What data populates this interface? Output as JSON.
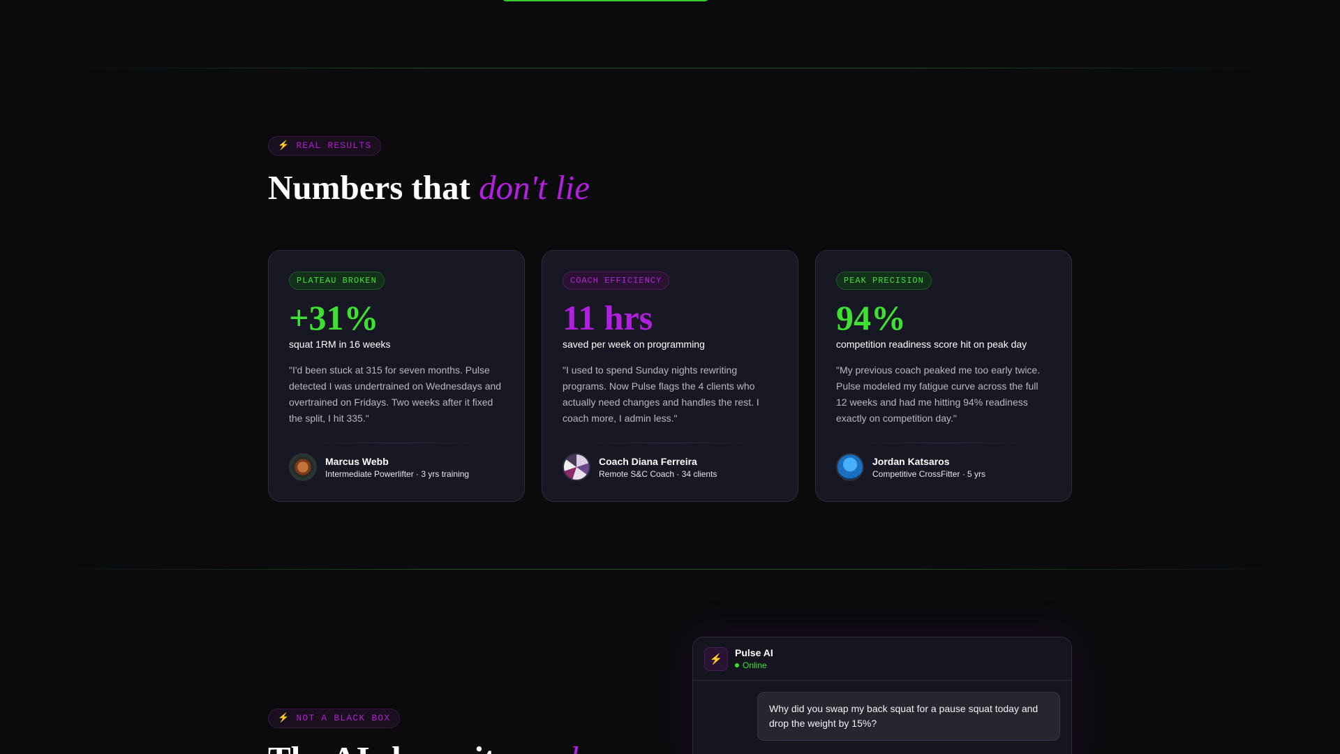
{
  "section1": {
    "eyebrow": "⚡ REAL RESULTS",
    "title_main": "Numbers that ",
    "title_accent": "don't lie"
  },
  "cards": [
    {
      "badge": "PLATEAU BROKEN",
      "metric": "+31%",
      "subtitle": "squat 1RM in 16 weeks",
      "quote": "\"I'd been stuck at 315 for seven months. Pulse detected I was undertrained on Wednesdays and overtrained on Fridays. Two weeks after it fixed the split, I hit 335.\"",
      "author": "Marcus Webb",
      "role": "Intermediate Powerlifter · 3 yrs training",
      "accent": "#3ee034"
    },
    {
      "badge": "COACH EFFICIENCY",
      "metric": "11 hrs",
      "subtitle": "saved per week on programming",
      "quote": "\"I used to spend Sunday nights rewriting programs. Now Pulse flags the 4 clients who actually need changes and handles the rest. I coach more, I admin less.\"",
      "author": "Coach Diana Ferreira",
      "role": "Remote S&C Coach · 34 clients",
      "accent": "#b01fe0"
    },
    {
      "badge": "PEAK PRECISION",
      "metric": "94%",
      "subtitle": "competition readiness score hit on peak day",
      "quote": "\"My previous coach peaked me too early twice. Pulse modeled my fatigue curve across the full 12 weeks and had me hitting 94% readiness exactly on competition day.\"",
      "author": "Jordan Katsaros",
      "role": "Competitive CrossFitter · 5 yrs",
      "accent": "#3ee034"
    }
  ],
  "section2": {
    "eyebrow": "⚡ NOT A BLACK BOX",
    "title_main": "The AI shows its ",
    "title_accent": "work"
  },
  "chat": {
    "logo_icon": "⚡",
    "title": "Pulse AI",
    "status": "Online",
    "user_message": "Why did you swap my back squat for a pause squat today and drop the weight by 15%?"
  }
}
